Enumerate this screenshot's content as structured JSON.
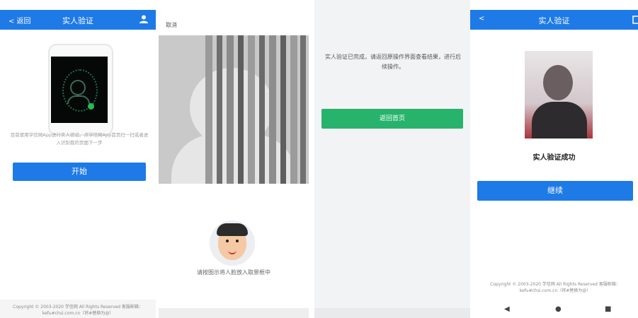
{
  "panel1": {
    "back": "< 返回",
    "title": "实人验证",
    "user_icon": "user-icon",
    "desc": "目前使用学信网App进行实人验证。点学信网App首页扫一扫或者进入识别我的页面下一步",
    "start_button": "开始",
    "footer": "Copyright © 2003-2020 学信网 All Rights Reserved 客服邮箱：kefu#chsi.com.cn（将#替换为@）"
  },
  "panel2": {
    "cancel": "取消",
    "hint": "请按图示将人脸放入取景框中"
  },
  "panel3": {
    "message": "实人验证已完成，请返回原操作界面查看结果，进行后续操作。",
    "home_button": "返回首页"
  },
  "panel4": {
    "back": "<",
    "title": "实人验证",
    "success": "实人验证成功",
    "continue_button": "继续",
    "footer": "Copyright © 2003-2020 学信网 All Rights Reserved 客服邮箱：kefu#chsi.com.cn（将#替换为@）",
    "nav_back": "◀",
    "nav_home": "●",
    "nav_recent": "■"
  },
  "colors": {
    "blue": "#1e7ae6",
    "green": "#27b36b"
  }
}
